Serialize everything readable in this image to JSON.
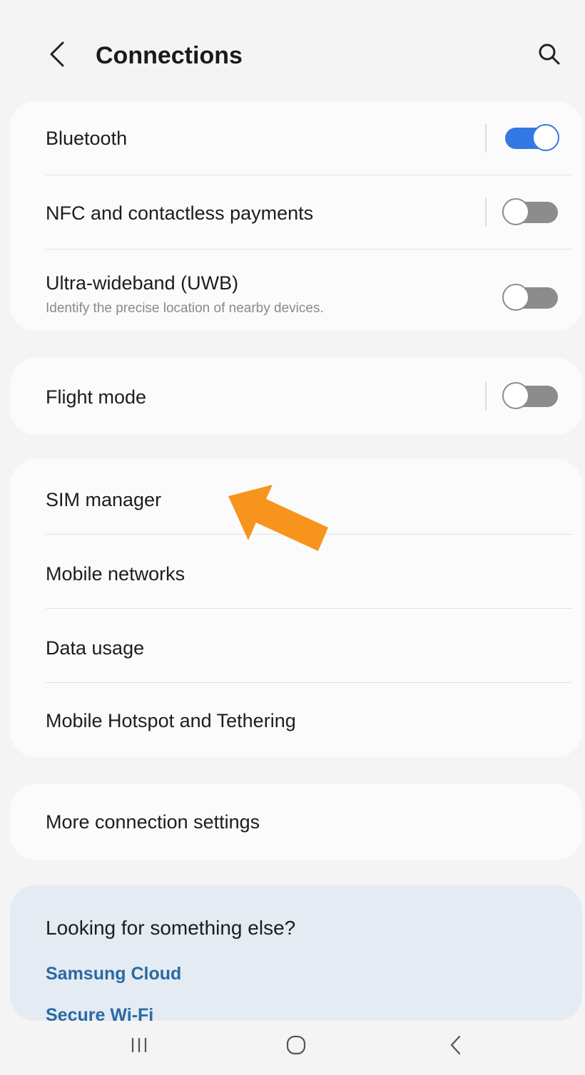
{
  "header": {
    "title": "Connections",
    "back_icon": "chevron-left-icon",
    "search_icon": "search-icon"
  },
  "group_radios": {
    "items": [
      {
        "label": "Bluetooth",
        "toggle": "on"
      },
      {
        "label": "NFC and contactless payments",
        "toggle": "off"
      },
      {
        "label": "Ultra-wideband (UWB)",
        "subtitle": "Identify the precise location of nearby devices.",
        "toggle": "off"
      }
    ]
  },
  "group_flight": {
    "items": [
      {
        "label": "Flight mode",
        "toggle": "off"
      }
    ]
  },
  "group_network": {
    "items": [
      {
        "label": "SIM manager"
      },
      {
        "label": "Mobile networks"
      },
      {
        "label": "Data usage"
      },
      {
        "label": "Mobile Hotspot and Tethering"
      }
    ]
  },
  "group_more": {
    "items": [
      {
        "label": "More connection settings"
      }
    ]
  },
  "help": {
    "title": "Looking for something else?",
    "links": [
      "Samsung Cloud",
      "Secure Wi-Fi"
    ]
  },
  "navbar": {
    "recents_icon": "recents-icon",
    "home_icon": "home-icon",
    "back_icon": "back-icon"
  },
  "colors": {
    "toggle_on": "#3478e6",
    "toggle_off": "#8c8c8c",
    "link": "#2a6aa3",
    "annotation_arrow": "#f7941d"
  }
}
